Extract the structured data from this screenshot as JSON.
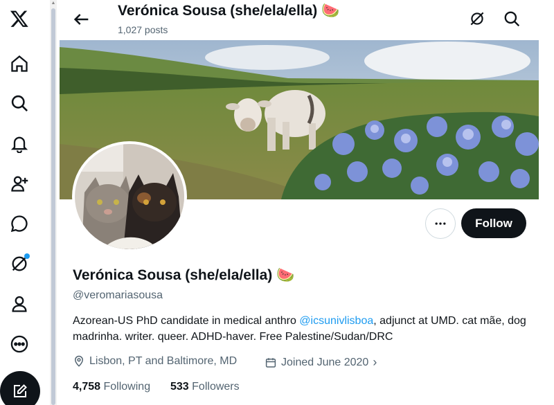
{
  "nav": {
    "items": [
      "x-logo",
      "home",
      "explore",
      "notifications",
      "follow",
      "messages",
      "grok",
      "profile",
      "more"
    ],
    "compose_icon": "compose-icon"
  },
  "header": {
    "name": "Verónica Sousa (she/ela/ella) 🍉",
    "posts": "1,027 posts"
  },
  "profile": {
    "name": "Verónica Sousa (she/ela/ella) 🍉",
    "handle": "@veromariasousa",
    "bio_before": "Azorean-US PhD candidate in medical anthro ",
    "bio_link": "@icsunivlisboa",
    "bio_after": ", adjunct at UMD. cat mãe, dog madrinha. writer. queer. ADHD-haver. Free Palestine/Sudan/DRC",
    "location": "Lisbon, PT and Baltimore, MD",
    "joined": "Joined June 2020",
    "following_count": "4,758",
    "following_label": "Following",
    "followers_count": "533",
    "followers_label": "Followers"
  },
  "actions": {
    "follow_label": "Follow"
  },
  "colors": {
    "accent": "#1d9bf0",
    "text": "#0f1419",
    "muted": "#536471"
  }
}
